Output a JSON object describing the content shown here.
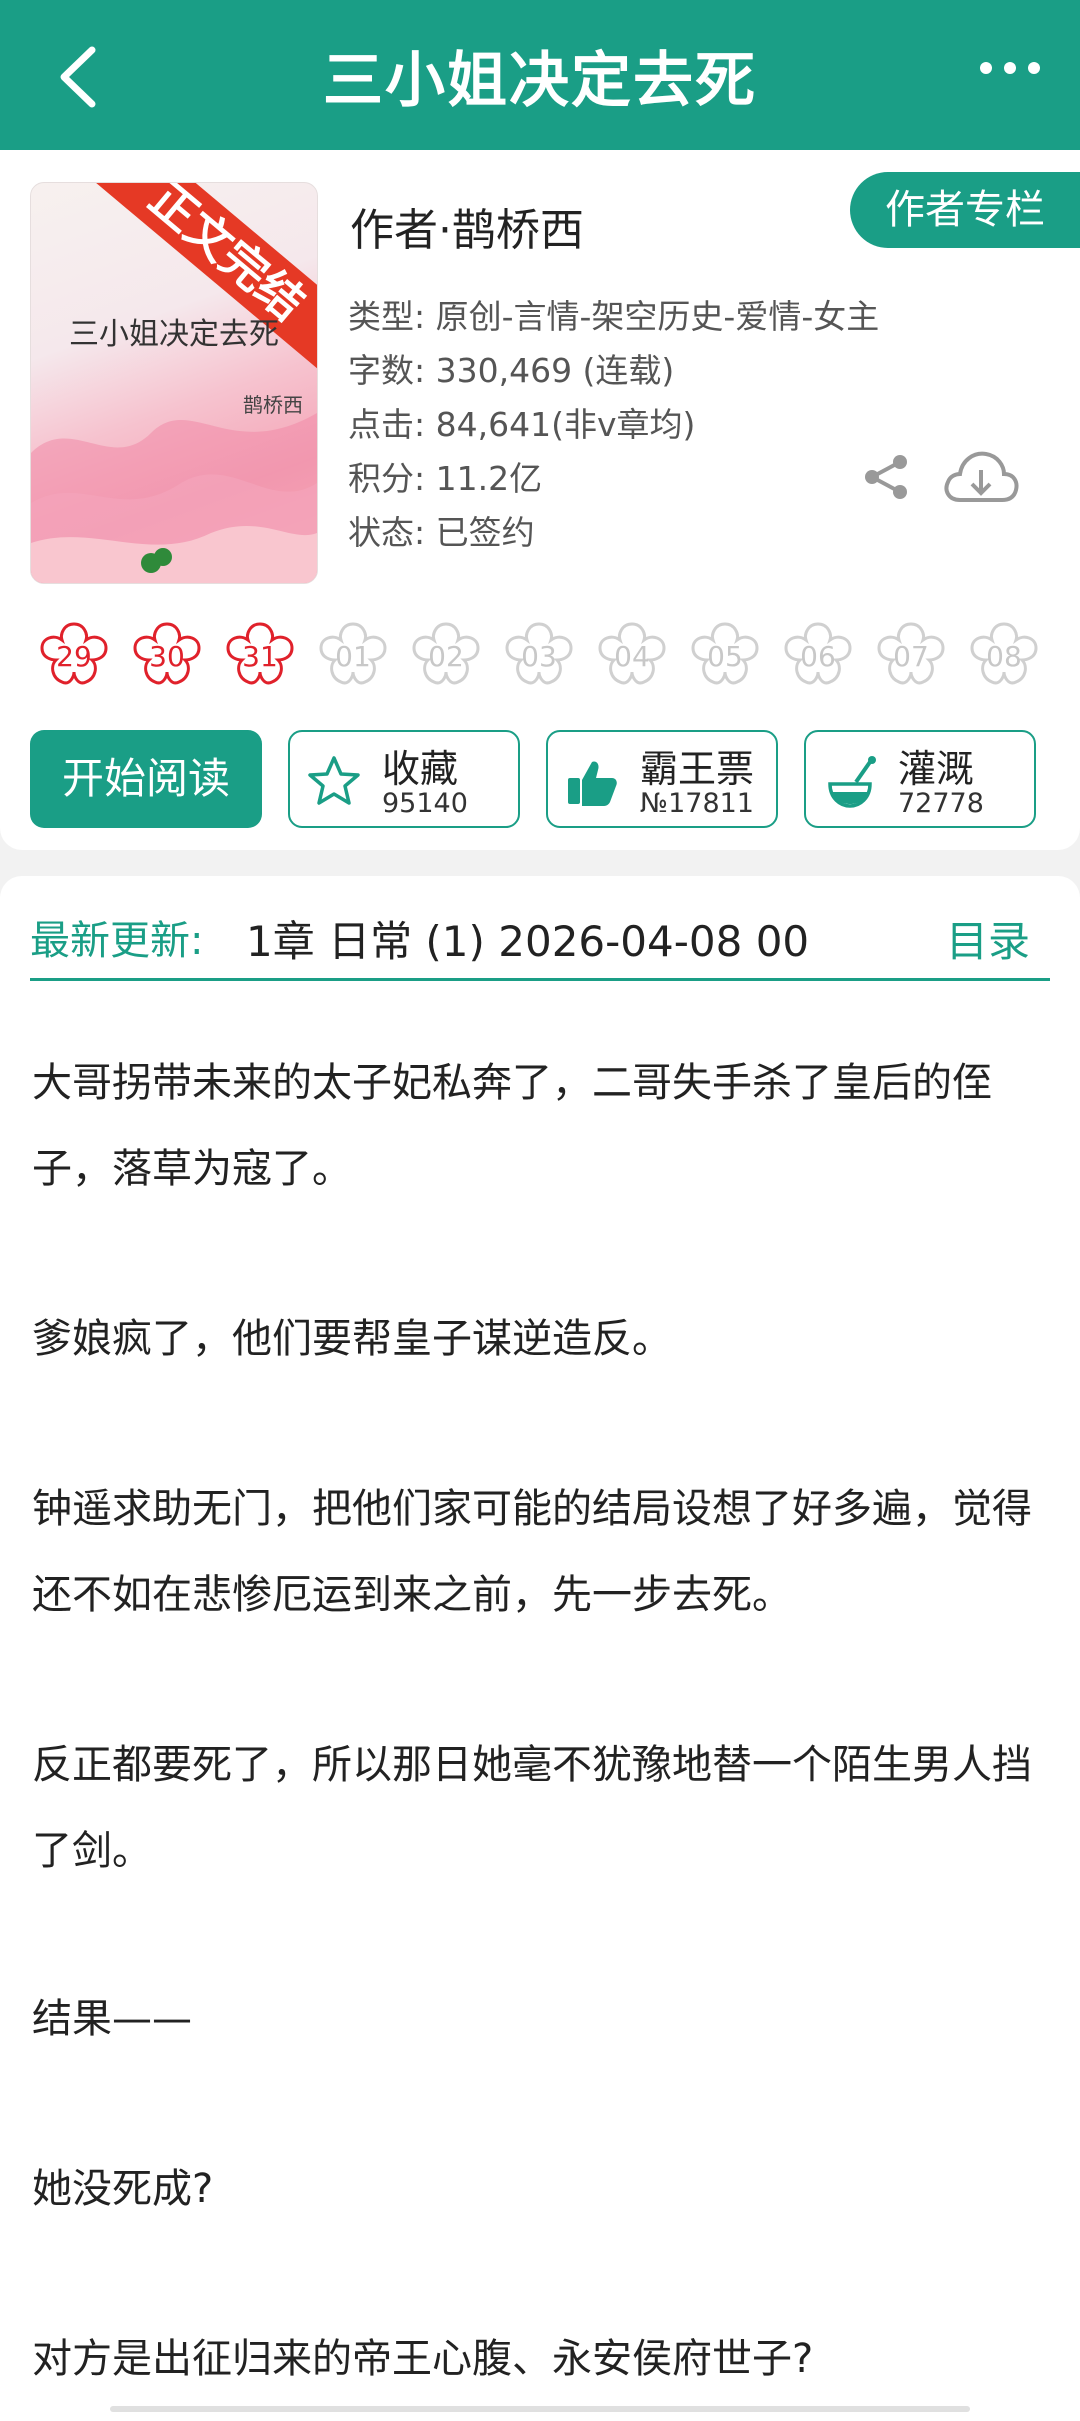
{
  "header": {
    "title": "三小姐决定去死"
  },
  "book": {
    "cover_title": "三小姐决定去死",
    "cover_author": "鹊桥西",
    "cover_badge": "正文完结",
    "author_line": "作者·鹊桥西",
    "author_column_button": "作者专栏",
    "meta": [
      "类型: 原创-言情-架空历史-爱情-女主",
      "字数: 330,469 (连载)",
      "点击: 84,641(非v章均)",
      "积分: 11.2亿",
      "状态: 已签约"
    ]
  },
  "ratings": [
    {
      "label": "29",
      "active": true
    },
    {
      "label": "30",
      "active": true
    },
    {
      "label": "31",
      "active": true
    },
    {
      "label": "01",
      "active": false
    },
    {
      "label": "02",
      "active": false
    },
    {
      "label": "03",
      "active": false
    },
    {
      "label": "04",
      "active": false
    },
    {
      "label": "05",
      "active": false
    },
    {
      "label": "06",
      "active": false
    },
    {
      "label": "07",
      "active": false
    },
    {
      "label": "08",
      "active": false
    }
  ],
  "actions": {
    "read": "开始阅读",
    "collect": {
      "label": "收藏",
      "count": "95140"
    },
    "ticket": {
      "label": "霸王票",
      "count": "№17811"
    },
    "water": {
      "label": "灌溉",
      "count": "72778"
    }
  },
  "latest": {
    "label": "最新更新:",
    "text": "1章  日常 (1)  2026-04-08 00",
    "catalog": "目录"
  },
  "synopsis": [
    "大哥拐带未来的太子妃私奔了，二哥失手杀了皇后的侄子，落草为寇了。",
    "爹娘疯了，他们要帮皇子谋逆造反。",
    "钟遥求助无门，把他们家可能的结局设想了好多遍，觉得还不如在悲惨厄运到来之前，先一步去死。",
    "反正都要死了，所以那日她毫不犹豫地替一个陌生男人挡了剑。",
    "结果——",
    "她没死成?",
    "对方是出征归来的帝王心腹、永安侯府世子?"
  ],
  "colors": {
    "primary": "#1a9e86",
    "rating_active": "#e0212b",
    "rating_inactive": "#d0d0d0"
  }
}
